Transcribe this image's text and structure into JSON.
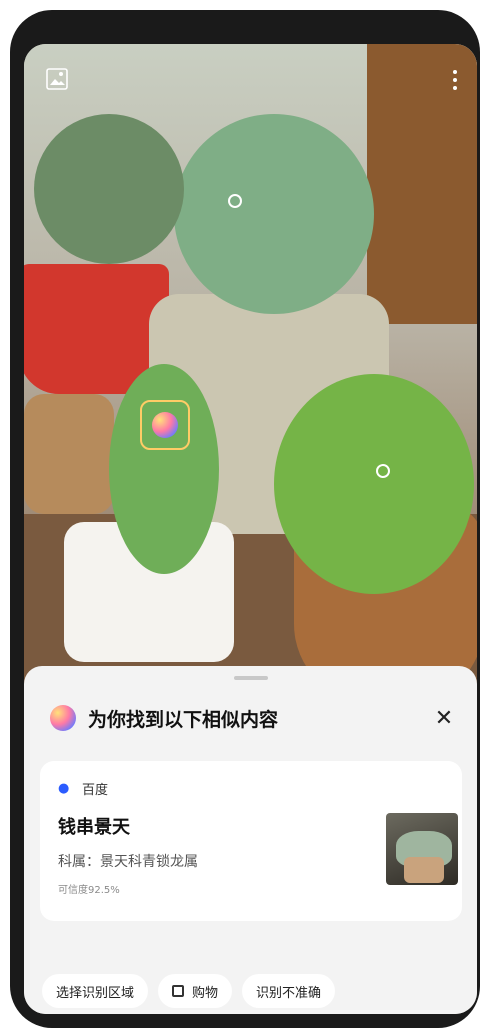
{
  "sheet": {
    "title": "为你找到以下相似内容",
    "close_icon": "close-icon"
  },
  "result": {
    "source": "百度",
    "name": "钱串景天",
    "family": "科属：景天科青锁龙属",
    "confidence": "可信度92.5%"
  },
  "actions": {
    "select_area": "选择识别区域",
    "shop": "购物",
    "inaccurate": "识别不准确"
  },
  "toolbar": {
    "gallery_icon": "image-icon",
    "more_icon": "more-icon"
  }
}
